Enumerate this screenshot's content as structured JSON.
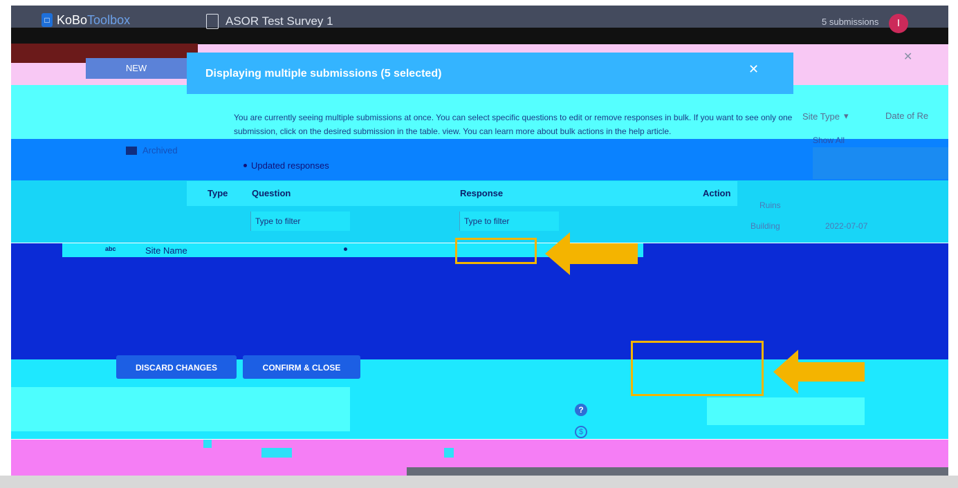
{
  "header": {
    "logo_prefix": "KoBo",
    "logo_suffix": "Toolbox",
    "project_title": "ASOR Test Survey 1",
    "submissions": "5 submissions",
    "avatar_initial": "I"
  },
  "sidebar": {
    "new_button": "NEW",
    "archived_label": "Archived"
  },
  "table_columns": {
    "site_type": "Site Type",
    "date_of_record": "Date of Re",
    "show_all": "Show All",
    "cell_ruins": "Ruins",
    "cell_building": "Building",
    "cell_date": "2022-07-07"
  },
  "modal": {
    "title": "Displaying multiple submissions (5 selected)",
    "notice": "You are currently seeing multiple submissions at once. You can select specific questions to edit or remove responses in bulk. If you want to see only one submission, click on the desired submission in the table. view. You can learn more about bulk actions in the help article.",
    "bullet": "Updated responses",
    "columns": {
      "type": "Type",
      "question": "Question",
      "response": "Response",
      "action": "Action"
    },
    "filter_placeholder_question": "Type to filter",
    "filter_placeholder_response": "Type to filter",
    "rows": [
      {
        "type_icon": "abc",
        "question": "Site Name"
      }
    ],
    "discard_button": "DISCARD CHANGES",
    "confirm_button": "CONFIRM & CLOSE"
  },
  "colors": {
    "header_bg": "#444b5e",
    "accent_blue": "#1c5fe4",
    "highlight": "#f4b400"
  }
}
